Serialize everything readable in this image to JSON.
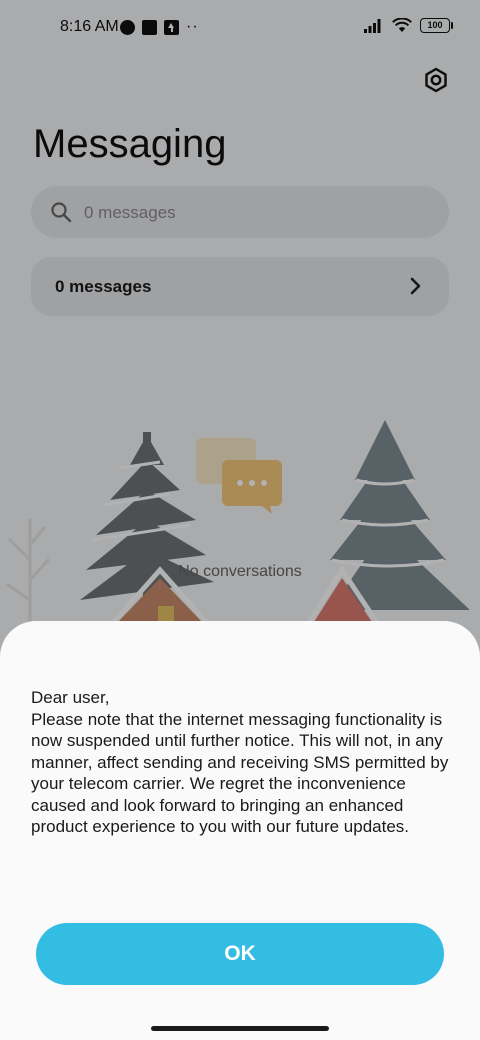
{
  "status_bar": {
    "time": "8:16 AM",
    "battery_level": "100",
    "notification_icons": [
      "app-circle-icon",
      "square-app-icon",
      "upload-arrow-icon",
      "more-dots-icon"
    ],
    "right_icons": [
      "signal-icon",
      "wifi-icon",
      "battery-icon"
    ]
  },
  "header": {
    "title": "Messaging",
    "settings_icon": "gear-icon"
  },
  "search": {
    "placeholder": "0 messages",
    "icon": "search-icon"
  },
  "messages_card": {
    "label": "0 messages",
    "icon": "chevron-right-icon"
  },
  "empty_state": {
    "label": "No conversations"
  },
  "dialog": {
    "greeting": "Dear user,",
    "body": "Please note that the internet messaging functionality is now suspended until further notice. This will not, in any manner, affect sending and receiving SMS permitted by your telecom carrier. We regret the inconvenience caused and look forward to bringing an enhanced product experience to you with our future updates.",
    "ok_label": "OK"
  },
  "colors": {
    "accent": "#34bde3",
    "background": "#f4f5f7",
    "card": "#e6e7ea",
    "dialog": "#fafafa"
  }
}
